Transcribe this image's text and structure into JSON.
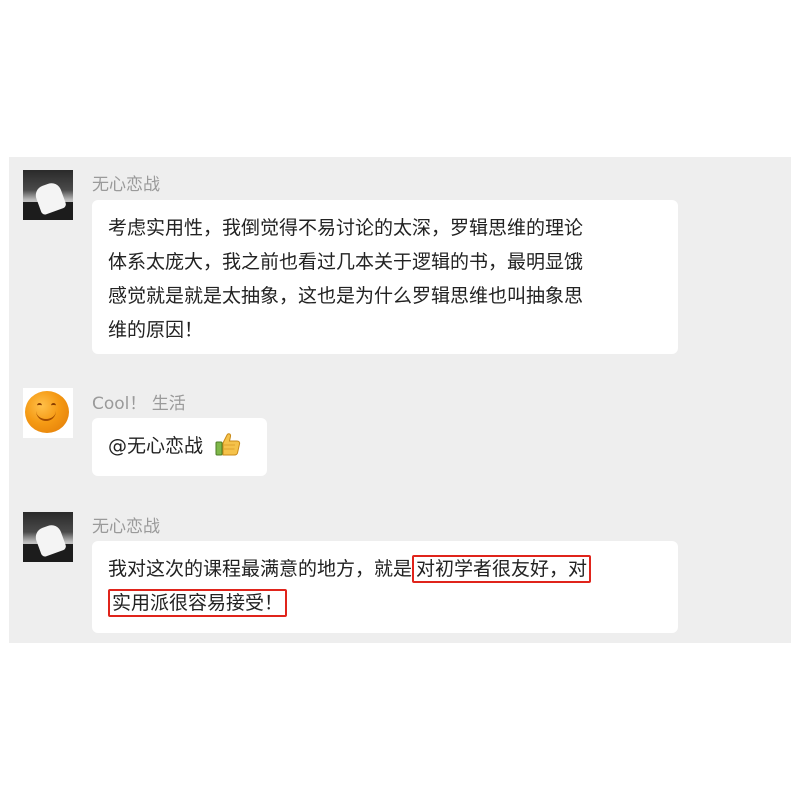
{
  "messages": [
    {
      "sender": "无心恋战",
      "avatar": "sofa-photo-avatar",
      "lines": [
        "考虑实用性，我倒觉得不易讨论的太深，罗辑思维的理论",
        "体系太庞大，我之前也看过几本关于逻辑的书，最明显饿",
        "感觉就是就是太抽象，这也是为什么罗辑思维也叫抽象思",
        "维的原因！"
      ]
    },
    {
      "sender": "Cool！ 生活",
      "avatar": "orange-avatar",
      "text": "@无心恋战",
      "emoji": "thumbs-up-icon"
    },
    {
      "sender": "无心恋战",
      "avatar": "sofa-photo-avatar",
      "line1_plain": "我对这次的课程最满意的地方，就是",
      "line1_highlight": "对初学者很友好，对",
      "line2_highlight": "实用派很容易接受！"
    }
  ],
  "colors": {
    "panel_bg": "#eeeeee",
    "bubble_bg": "#ffffff",
    "sender_name": "#9a9a9a",
    "highlight_border": "#e0241b"
  }
}
